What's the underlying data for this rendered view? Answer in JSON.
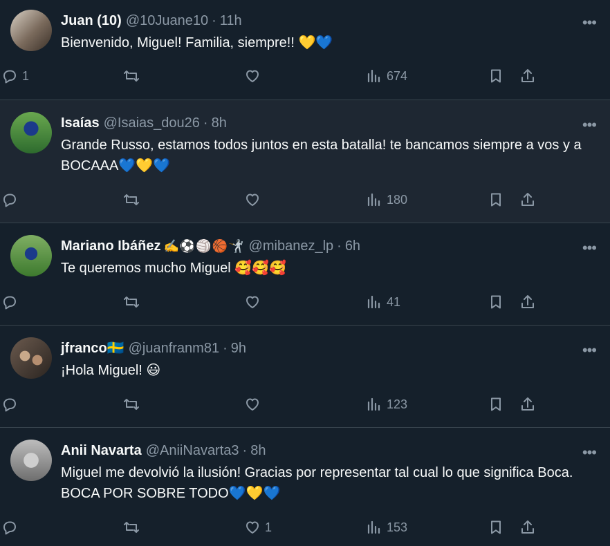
{
  "tweets": [
    {
      "name": "Juan (10)",
      "emojis": "",
      "handle": "@10Juane10",
      "time": "11h",
      "text": "Bienvenido, Miguel! Familia, siempre!! 💛💙",
      "replies": "1",
      "retweets": "",
      "likes": "",
      "views": "674",
      "avatar_colors": [
        "#8a7a6a",
        "#d9d2c8"
      ]
    },
    {
      "name": "Isaías",
      "emojis": "",
      "handle": "@Isaias_dou26",
      "time": "8h",
      "text": "Grande Russo, estamos todos juntos en esta batalla! te bancamos siempre a vos y a BOCAAA💙💛💙",
      "replies": "",
      "retweets": "",
      "likes": "",
      "views": "180",
      "avatar_colors": [
        "#3a7a3a",
        "#1b3a8a"
      ]
    },
    {
      "name": "Mariano Ibáñez",
      "emojis": "✍️⚽🏐🏀🤺",
      "handle": "@mibanez_lp",
      "time": "6h",
      "text": "Te queremos mucho Miguel 🥰🥰🥰",
      "replies": "",
      "retweets": "",
      "likes": "",
      "views": "41",
      "avatar_colors": [
        "#4d8a3a",
        "#1b3a8a"
      ]
    },
    {
      "name": "jfranco🇸🇪",
      "emojis": "",
      "handle": "@juanfranm81",
      "time": "9h",
      "text": "¡Hola Miguel! 😃",
      "replies": "",
      "retweets": "",
      "likes": "",
      "views": "123",
      "avatar_colors": [
        "#5a4a40",
        "#c9a98a"
      ]
    },
    {
      "name": "Anii Navarta",
      "emojis": "",
      "handle": "@AniiNavarta3",
      "time": "8h",
      "text": "Miguel me devolvió la ilusión! Gracias por representar tal cual lo que significa Boca. BOCA POR SOBRE TODO💙💛💙",
      "replies": "",
      "retweets": "",
      "likes": "1",
      "views": "153",
      "avatar_colors": [
        "#9a9a9a",
        "#d0d0d0"
      ]
    }
  ],
  "colors": {
    "background": "#15202b",
    "muted": "#8b98a5",
    "divider": "#38444d",
    "text": "#f7f9f9"
  },
  "icons": {
    "reply": "reply-icon",
    "retweet": "retweet-icon",
    "like": "heart-icon",
    "views": "views-icon",
    "bookmark": "bookmark-icon",
    "share": "share-icon",
    "more": "more-icon"
  }
}
